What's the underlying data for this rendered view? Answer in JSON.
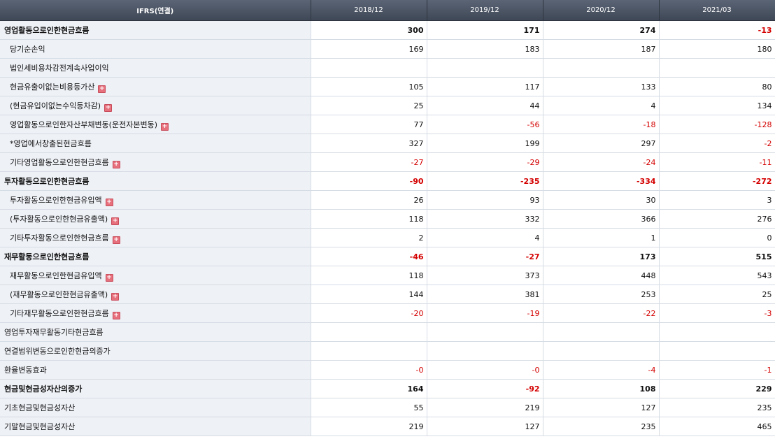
{
  "table": {
    "header": {
      "label": "IFRS(연결)",
      "periods": [
        "2018/12",
        "2019/12",
        "2020/12",
        "2021/03"
      ]
    },
    "rows": [
      {
        "label": "영업활동으로인한현금흐름",
        "level": 0,
        "bold": true,
        "expand": false,
        "values": [
          "300",
          "171",
          "274",
          "-13"
        ]
      },
      {
        "label": "당기순손익",
        "level": 1,
        "bold": false,
        "expand": false,
        "values": [
          "169",
          "183",
          "187",
          "180"
        ]
      },
      {
        "label": "법인세비용차감전계속사업이익",
        "level": 1,
        "bold": false,
        "expand": false,
        "values": [
          "",
          "",
          "",
          ""
        ]
      },
      {
        "label": "현금유출이없는비용등가산",
        "level": 1,
        "bold": false,
        "expand": true,
        "values": [
          "105",
          "117",
          "133",
          "80"
        ]
      },
      {
        "label": "(현금유입이없는수익등차감)",
        "level": 1,
        "bold": false,
        "expand": true,
        "values": [
          "25",
          "44",
          "4",
          "134"
        ]
      },
      {
        "label": "영업활동으로인한자산부채변동(운전자본변동)",
        "level": 1,
        "bold": false,
        "expand": true,
        "values": [
          "77",
          "-56",
          "-18",
          "-128"
        ]
      },
      {
        "label": "*영업에서창출된현금흐름",
        "level": 1,
        "bold": false,
        "expand": false,
        "values": [
          "327",
          "199",
          "297",
          "-2"
        ]
      },
      {
        "label": "기타영업활동으로인한현금흐름",
        "level": 1,
        "bold": false,
        "expand": true,
        "values": [
          "-27",
          "-29",
          "-24",
          "-11"
        ]
      },
      {
        "label": "투자활동으로인한현금흐름",
        "level": 0,
        "bold": true,
        "expand": false,
        "values": [
          "-90",
          "-235",
          "-334",
          "-272"
        ]
      },
      {
        "label": "투자활동으로인한현금유입액",
        "level": 1,
        "bold": false,
        "expand": true,
        "values": [
          "26",
          "93",
          "30",
          "3"
        ]
      },
      {
        "label": "(투자활동으로인한현금유출액)",
        "level": 1,
        "bold": false,
        "expand": true,
        "values": [
          "118",
          "332",
          "366",
          "276"
        ]
      },
      {
        "label": "기타투자활동으로인한현금흐름",
        "level": 1,
        "bold": false,
        "expand": true,
        "values": [
          "2",
          "4",
          "1",
          "0"
        ]
      },
      {
        "label": "재무활동으로인한현금흐름",
        "level": 0,
        "bold": true,
        "expand": false,
        "values": [
          "-46",
          "-27",
          "173",
          "515"
        ]
      },
      {
        "label": "재무활동으로인한현금유입액",
        "level": 1,
        "bold": false,
        "expand": true,
        "values": [
          "118",
          "373",
          "448",
          "543"
        ]
      },
      {
        "label": "(재무활동으로인한현금유출액)",
        "level": 1,
        "bold": false,
        "expand": true,
        "values": [
          "144",
          "381",
          "253",
          "25"
        ]
      },
      {
        "label": "기타재무활동으로인한현금흐름",
        "level": 1,
        "bold": false,
        "expand": true,
        "values": [
          "-20",
          "-19",
          "-22",
          "-3"
        ]
      },
      {
        "label": "영업투자재무활동기타현금흐름",
        "level": 0,
        "bold": false,
        "expand": false,
        "values": [
          "",
          "",
          "",
          ""
        ]
      },
      {
        "label": "연결범위변동으로인한현금의증가",
        "level": 0,
        "bold": false,
        "expand": false,
        "values": [
          "",
          "",
          "",
          ""
        ]
      },
      {
        "label": "환율변동효과",
        "level": 0,
        "bold": false,
        "expand": false,
        "values": [
          "-0",
          "-0",
          "-4",
          "-1"
        ]
      },
      {
        "label": "현금및현금성자산의증가",
        "level": 0,
        "bold": true,
        "expand": false,
        "values": [
          "164",
          "-92",
          "108",
          "229"
        ]
      },
      {
        "label": "기초현금및현금성자산",
        "level": 0,
        "bold": false,
        "expand": false,
        "values": [
          "55",
          "219",
          "127",
          "235"
        ]
      },
      {
        "label": "기말현금및현금성자산",
        "level": 0,
        "bold": false,
        "expand": false,
        "values": [
          "219",
          "127",
          "235",
          "465"
        ]
      }
    ],
    "expand_icon_glyph": "+",
    "colors": {
      "header_bg": "#4b5564",
      "label_bg": "#eef1f6",
      "negative": "#d40000",
      "expand_icon": "#e7707d"
    }
  }
}
